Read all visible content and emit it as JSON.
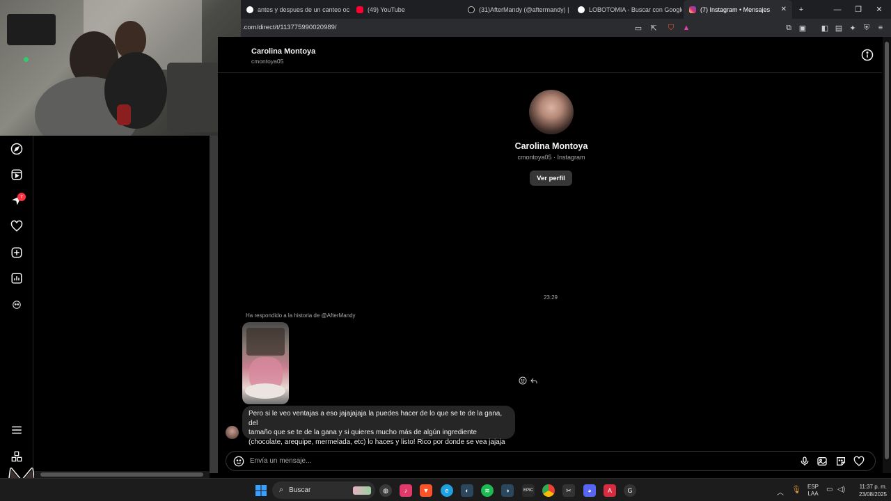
{
  "browser": {
    "tabs": [
      {
        "label": "antes y despues de un canteo ocul",
        "icon": "google-icon"
      },
      {
        "label": "(49) YouTube",
        "icon": "youtube-icon"
      },
      {
        "label": "(31)AfterMandy (@aftermandy) | Ti",
        "icon": "tiktok-icon"
      },
      {
        "label": "LOBOTOMIA - Buscar con Google",
        "icon": "google-icon"
      },
      {
        "label": "(7) Instagram • Mensajes",
        "icon": "instagram-icon"
      }
    ],
    "new_tab": "+",
    "url": ".com/direct/t/113775990020989/"
  },
  "nav": {
    "notifications_badge": "7"
  },
  "chat": {
    "header_name": "Carolina Montoya",
    "header_username": "cmontoya05",
    "profile_name": "Carolina Montoya",
    "profile_sub": "cmontoya05 · Instagram",
    "view_profile": "Ver perfil",
    "timestamp": "23:29",
    "reply_note": "Ha respondido a la historia de @AfterMandy",
    "message_lines": [
      "Pero si le veo ventajas a eso jajajajaja la puedes hacer de lo que se te de la gana, del",
      "tamaño que se te de la gana y si quieres mucho más de algún ingrediente",
      "(chocolate, arequipe, mermelada, etc) lo haces y listo! Rico por donde se vea jajaja"
    ],
    "input_placeholder": "Envía un mensaje..."
  },
  "taskbar": {
    "search_label": "Buscar",
    "lang_top": "ESP",
    "lang_bottom": "LAA",
    "time": "11:37 p. m.",
    "date": "23/08/2025"
  },
  "colors": {
    "background": "#000000",
    "bubble": "#262626",
    "button": "#363636",
    "badge": "#ff3040"
  }
}
